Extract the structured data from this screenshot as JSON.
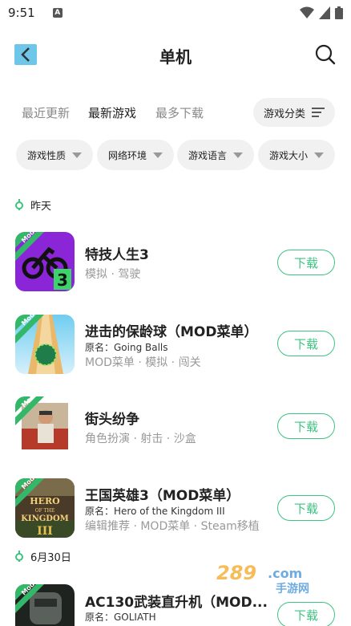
{
  "status": {
    "time": "9:51",
    "notif": "A"
  },
  "header": {
    "title": "单机"
  },
  "tabs": [
    {
      "label": "最近更新"
    },
    {
      "label": "最新游戏"
    },
    {
      "label": "最多下载"
    }
  ],
  "category_button": {
    "label": "游戏分类"
  },
  "filters": [
    {
      "label": "游戏性质"
    },
    {
      "label": "网络环境"
    },
    {
      "label": "游戏语言"
    },
    {
      "label": "游戏大小"
    }
  ],
  "sections": [
    {
      "date": "昨天"
    },
    {
      "date": "6月30日"
    }
  ],
  "apps": [
    {
      "title": "特技人生3",
      "orig": "",
      "tags": "模拟 · 驾驶",
      "badge": "Mod",
      "button": "下载"
    },
    {
      "title": "进击的保龄球（MOD菜单）",
      "orig": "原名：Going Balls",
      "tags": "MOD菜单 · 模拟 · 闯关",
      "badge": "Mod",
      "button": "下载"
    },
    {
      "title": "街头纷争",
      "orig": "",
      "tags": "角色扮演 · 射击 · 沙盒",
      "badge": "Mod",
      "button": "下载"
    },
    {
      "title": "王国英雄3（MOD菜单）",
      "orig": "原名：Hero of the Kingdom III",
      "tags": "编辑推荐 · MOD菜单 · Steam移植",
      "badge": "Mod",
      "button": "下载"
    },
    {
      "title": "AC130武装直升机（MOD...",
      "orig": "原名：GOLIATH",
      "tags": "",
      "badge": "Mod",
      "button": "下载"
    }
  ],
  "icon_texts": {
    "hero_logo": "HERO OF THE KINGDOM III",
    "bike_number": "3"
  },
  "watermark": {
    "brand": "289",
    "suffix": ".com",
    "cn": "手游网"
  },
  "colors": {
    "accent": "#3cc480",
    "back": "#6ec6e8"
  }
}
